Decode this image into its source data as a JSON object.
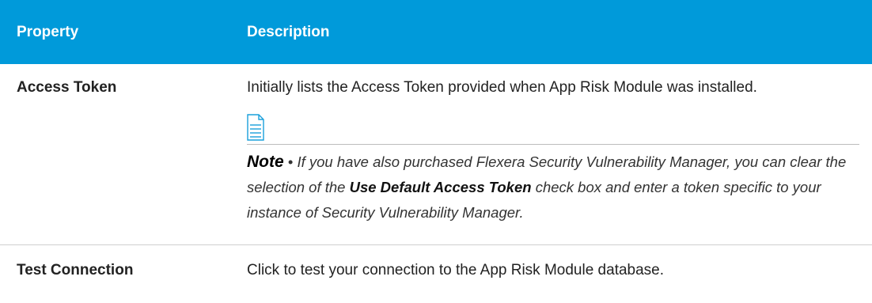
{
  "table": {
    "headers": {
      "property": "Property",
      "description": "Description"
    },
    "rows": [
      {
        "property": "Access Token",
        "description": "Initially lists the Access Token provided when App Risk Module was installed.",
        "note": {
          "icon": "note-document-icon",
          "label": "Note",
          "bullet": " • ",
          "text_1": "If you have also purchased Flexera Security Vulnerability Manager, you can clear the selection of the ",
          "strong": "Use Default Access Token",
          "text_2": " check box and enter a token specific to your instance of Security Vulnerability Manager."
        }
      },
      {
        "property": "Test Connection",
        "description": "Click to test your connection to the App Risk Module database."
      }
    ]
  },
  "colors": {
    "header_bg": "#009ada",
    "header_text": "#ffffff",
    "icon_stroke": "#1aa0db"
  }
}
